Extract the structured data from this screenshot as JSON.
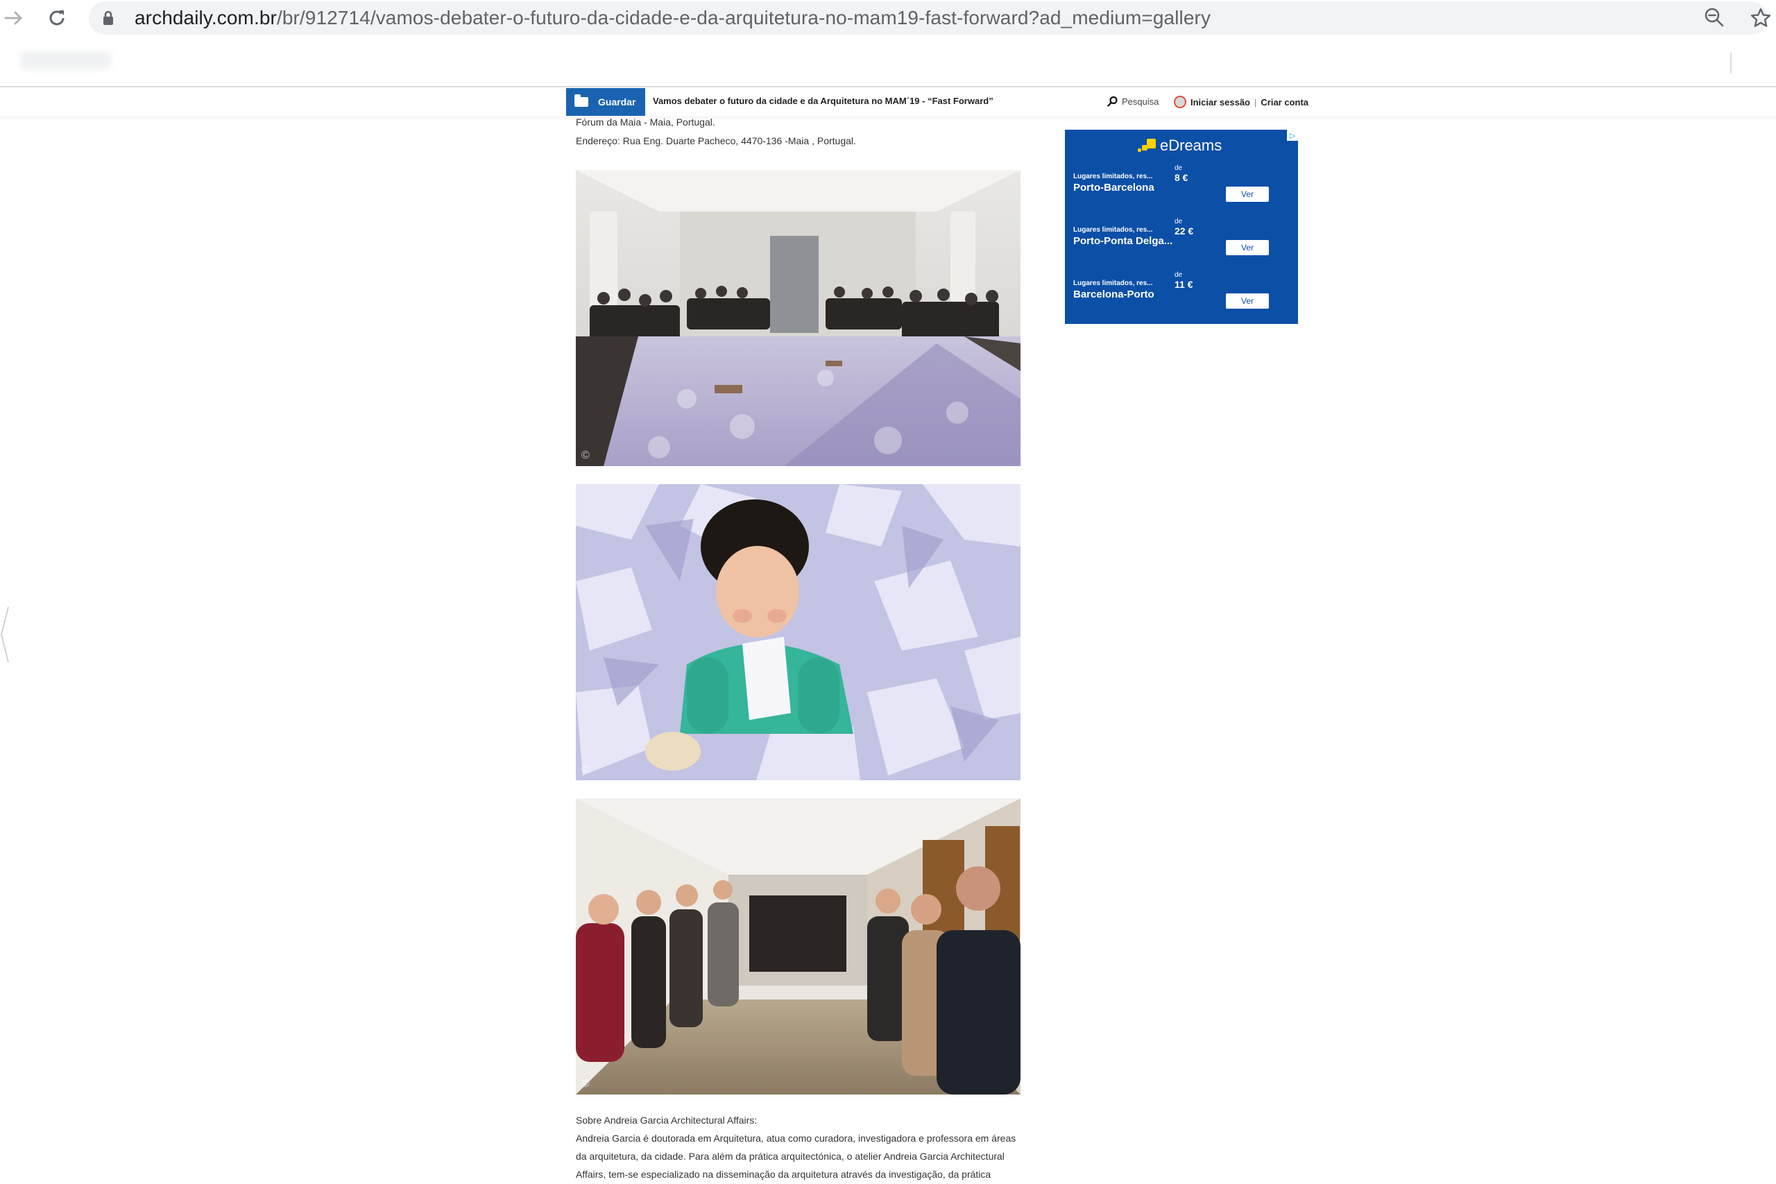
{
  "browser": {
    "url_host": "archdaily.com.br",
    "url_path": "/br/912714/vamos-debater-o-futuro-da-cidade-e-da-arquitetura-no-mam19-fast-forward?ad_medium=gallery",
    "icons": [
      "forward-arrow-icon",
      "reload-icon",
      "lock-icon",
      "zoom-icon",
      "star-icon"
    ]
  },
  "site_header": {
    "save_label": "Guardar",
    "title": "Vamos debater o futuro da cidade e da Arquitetura no MAM´19 - “Fast Forward”",
    "search_label": "Pesquisa",
    "login_label": "Iniciar sessão",
    "separator": "|",
    "signup_label": "Criar conta"
  },
  "article": {
    "venue_line": "Fórum da Maia - Maia, Portugal.",
    "address_line": "Endereço: Rua Eng. Duarte Pacheco, 4470-136 -Maia , Portugal.",
    "photo_credit_symbol": "©",
    "about_heading": "Sobre Andreia Garcia Architectural Affairs:",
    "about_lines": [
      "Andreia Garcia é doutorada em Arquitetura, atua como curadora, investigadora e professora em áreas",
      "da arquitetura, da cidade. Para além da prática arquitectónica, o atelier Andreia Garcia Architectural",
      "Affairs, tem-se especializado na disseminação da arquitetura através da investigação, da prática"
    ]
  },
  "ad": {
    "brand": "eDreams",
    "badge": "▷",
    "offers": [
      {
        "limit": "Lugares limitados, res...",
        "route": "Porto-Barcelona",
        "from": "de",
        "price": "8 €",
        "button": "Ver"
      },
      {
        "limit": "Lugares limitados, res...",
        "route": "Porto-Ponta Delga...",
        "from": "de",
        "price": "22 €",
        "button": "Ver"
      },
      {
        "limit": "Lugares limitados, res...",
        "route": "Barcelona-Porto",
        "from": "de",
        "price": "11 €",
        "button": "Ver"
      }
    ]
  },
  "colors": {
    "save_button": "#1a63b0",
    "ad_background": "#0b4fa7",
    "ad_logo": "#ffd400"
  }
}
